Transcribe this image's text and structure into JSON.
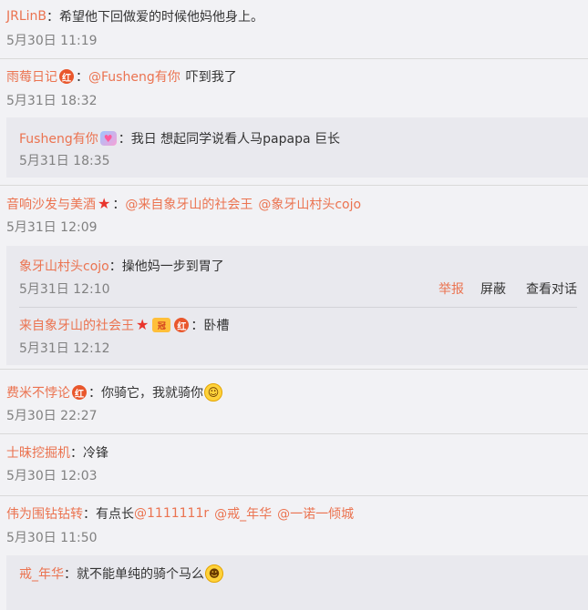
{
  "comments": [
    {
      "user": "JRLinB",
      "colon": "：",
      "text": "希望他下回做爱的时候他妈他身上。",
      "time": "5月30日 11:19"
    },
    {
      "user": "雨莓日记",
      "badge": "红",
      "colon": "：",
      "mention": "@Fusheng有你",
      "text": "吓到我了",
      "time": "5月31日 18:32",
      "reply": {
        "user": "Fusheng有你",
        "badge": "♥",
        "colon": "：",
        "text": "我日 想起同学说看人马papapa 巨长",
        "time": "5月31日 18:35"
      }
    },
    {
      "user": "音响沙发与美酒",
      "badge": "★",
      "colon": "：",
      "mention1": "@来自象牙山的社会王",
      "mention2": "@象牙山村头cojo",
      "time": "5月31日 12:09",
      "replies": [
        {
          "user": "象牙山村头cojo",
          "colon": "：",
          "text": "操他妈一步到胃了",
          "time": "5月31日 12:10",
          "actions": {
            "report": "举报",
            "block": "屏蔽",
            "view": "查看对话"
          }
        },
        {
          "user": "来自象牙山的社会王",
          "badge_star": "★",
          "badge_crown": "冠",
          "badge_red": "红",
          "colon": "：",
          "text": "卧槽",
          "time": "5月31日 12:12"
        }
      ]
    },
    {
      "user": "费米不悖论",
      "badge": "红",
      "colon": "：",
      "text": "你骑它，我就骑你",
      "emoji": "smile-emoji",
      "time": "5月30日 22:27"
    },
    {
      "user": "士昧挖掘机",
      "colon": "：",
      "text": "冷锋",
      "time": "5月30日 12:03"
    },
    {
      "user": "伟为围钻钻转",
      "colon": "：",
      "text": "有点长",
      "mention1": "@1111111r",
      "mention2": "@戒_年华",
      "mention3": "@一诺一倾城",
      "time": "5月30日 11:50",
      "reply": {
        "user": "戒_年华",
        "colon": "：",
        "text": "就不能单纯的骑个马么",
        "emoji": "grin-emoji"
      }
    }
  ]
}
